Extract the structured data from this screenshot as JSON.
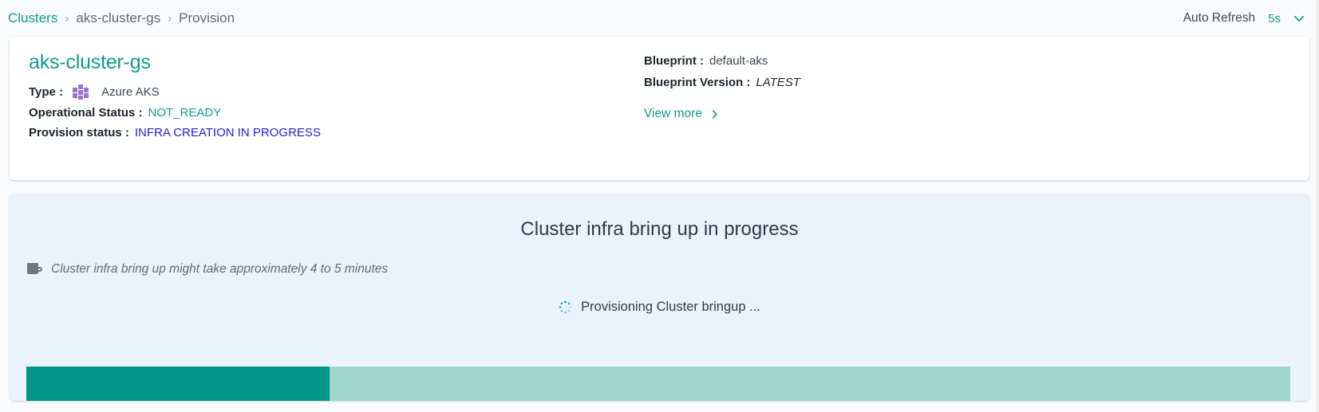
{
  "breadcrumb": {
    "root": "Clusters",
    "separator": "›",
    "cluster": "aks-cluster-gs",
    "current": "Provision"
  },
  "topbar": {
    "auto_refresh_label": "Auto Refresh",
    "auto_refresh_value": "5s",
    "chevron_icon": "chevron-down-icon"
  },
  "info": {
    "title": "aks-cluster-gs",
    "type_label": "Type :",
    "type_value": "Azure AKS",
    "type_icon": "azure-aks-icon",
    "operational_status_label": "Operational Status :",
    "operational_status_value": "NOT_READY",
    "provision_status_label": "Provision status :",
    "provision_status_value": "INFRA CREATION IN PROGRESS",
    "blueprint_label": "Blueprint :",
    "blueprint_value": "default-aks",
    "blueprint_version_label": "Blueprint Version :",
    "blueprint_version_value": "LATEST",
    "view_more_label": "View more",
    "view_more_icon": "chevron-right-icon"
  },
  "progress": {
    "heading": "Cluster infra bring up in progress",
    "note_icon": "coffee-mug-icon",
    "note": "Cluster infra bring up might take approximately 4 to 5 minutes",
    "spinner_icon": "loading-spinner-icon",
    "status": "Provisioning Cluster bringup ...",
    "percent": 24
  },
  "colors": {
    "teal": "#0f9b92",
    "progress_fill": "#009688",
    "progress_track": "#9fd7d0",
    "provision_status": "#2222dd",
    "panel_bg": "#eaf3fc",
    "aks_purple": "#9a74c8"
  }
}
